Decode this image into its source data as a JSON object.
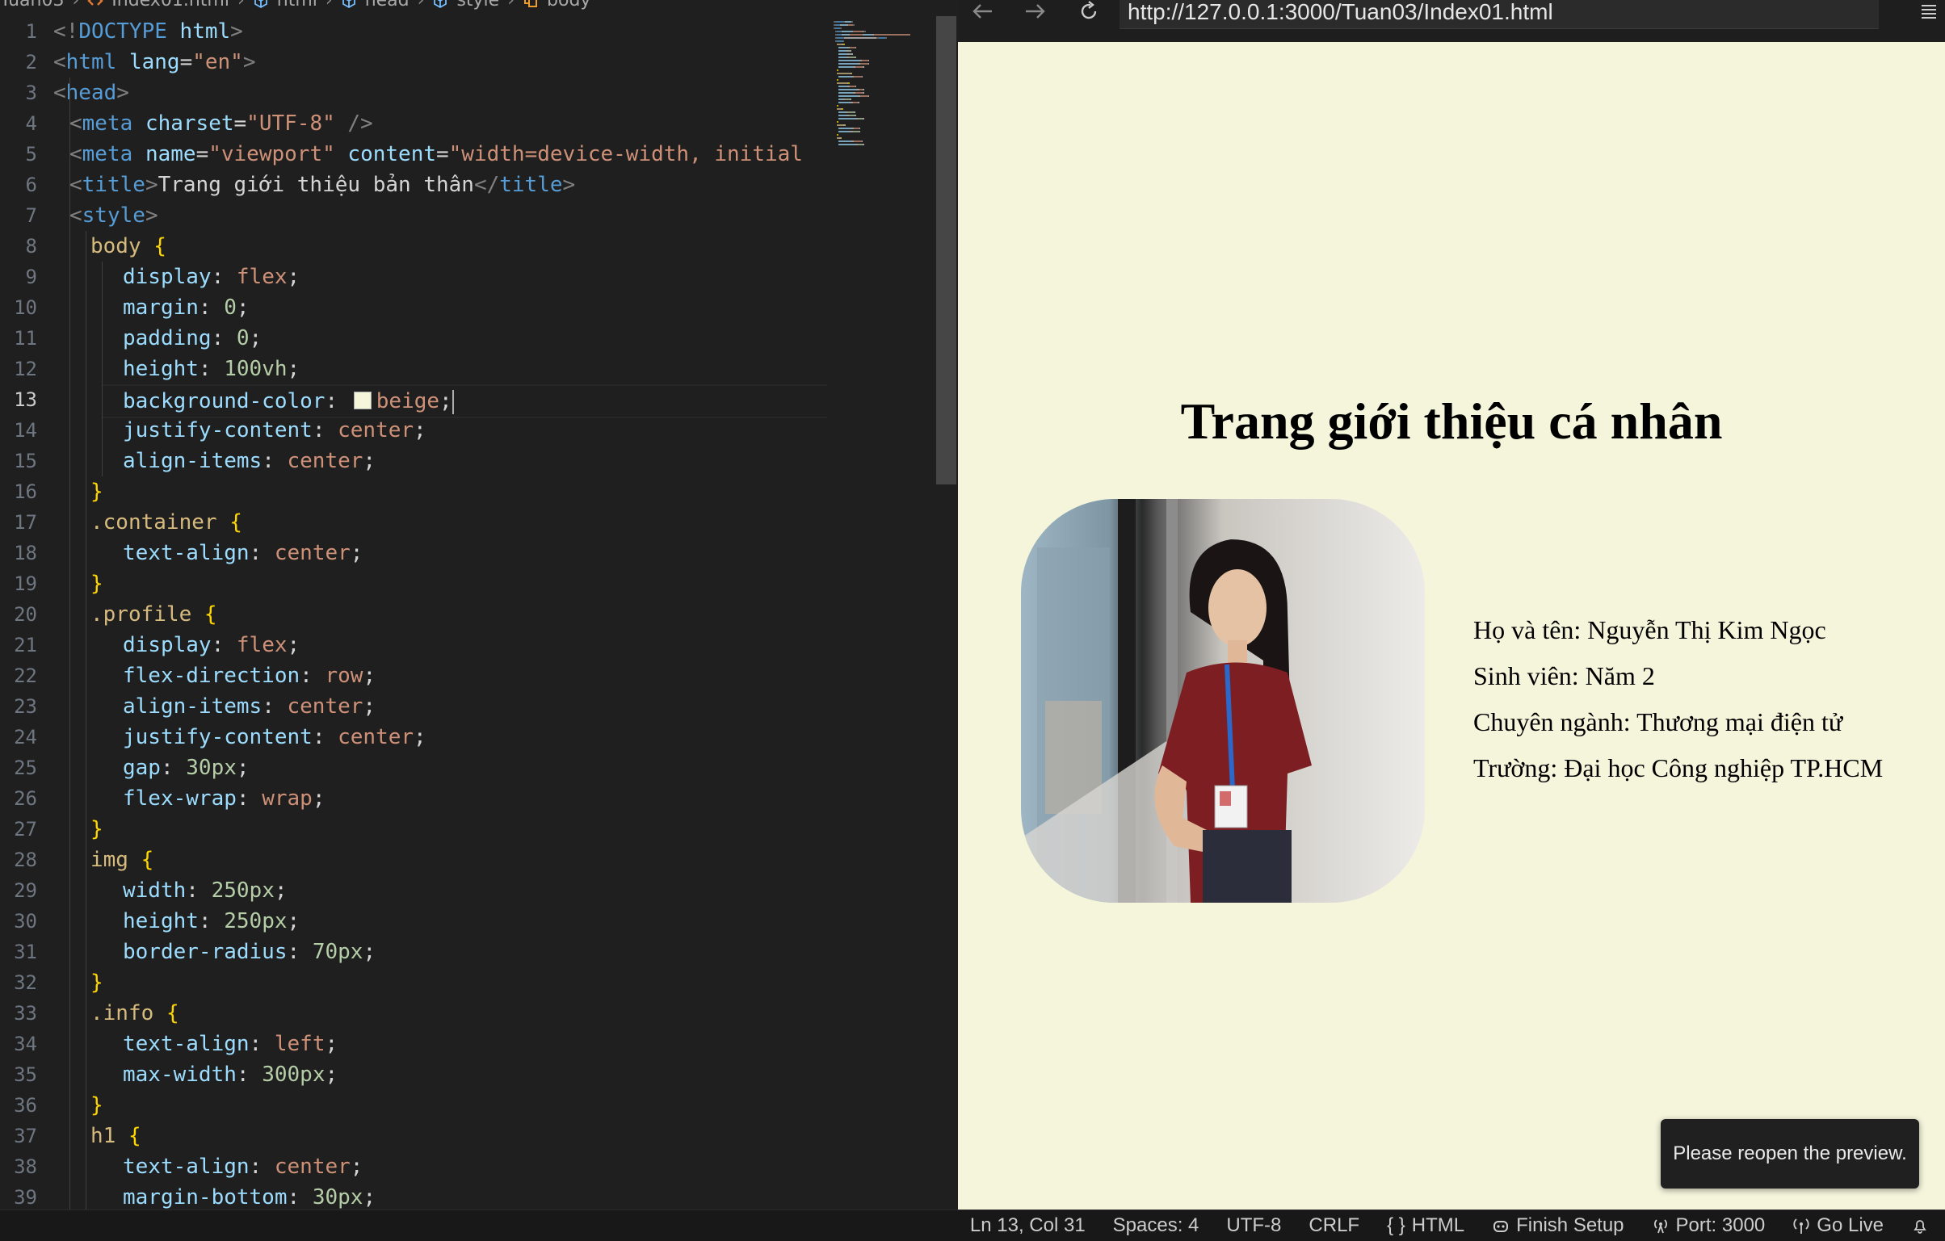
{
  "breadcrumb": [
    "Tuan03",
    "Index01.html",
    "html",
    "head",
    "style",
    "body"
  ],
  "editor": {
    "active_line": 13,
    "lines": [
      {
        "n": 1,
        "indent": 0,
        "tokens": [
          [
            "punc",
            "<!"
          ],
          [
            "tag",
            "DOCTYPE"
          ],
          [
            "text",
            " "
          ],
          [
            "attr",
            "html"
          ],
          [
            "punc",
            ">"
          ]
        ]
      },
      {
        "n": 2,
        "indent": 0,
        "tokens": [
          [
            "punc",
            "<"
          ],
          [
            "tag",
            "html"
          ],
          [
            "text",
            " "
          ],
          [
            "attr",
            "lang"
          ],
          [
            "text",
            "="
          ],
          [
            "str",
            "\"en\""
          ],
          [
            "punc",
            ">"
          ]
        ]
      },
      {
        "n": 3,
        "indent": 0,
        "tokens": [
          [
            "punc",
            "<"
          ],
          [
            "tag",
            "head"
          ],
          [
            "punc",
            ">"
          ]
        ]
      },
      {
        "n": 4,
        "indent": 1,
        "tokens": [
          [
            "punc",
            "<"
          ],
          [
            "tag",
            "meta"
          ],
          [
            "text",
            " "
          ],
          [
            "attr",
            "charset"
          ],
          [
            "text",
            "="
          ],
          [
            "str",
            "\"UTF-8\""
          ],
          [
            "text",
            " "
          ],
          [
            "punc",
            "/>"
          ]
        ]
      },
      {
        "n": 5,
        "indent": 1,
        "tokens": [
          [
            "punc",
            "<"
          ],
          [
            "tag",
            "meta"
          ],
          [
            "text",
            " "
          ],
          [
            "attr",
            "name"
          ],
          [
            "text",
            "="
          ],
          [
            "str",
            "\"viewport\""
          ],
          [
            "text",
            " "
          ],
          [
            "attr",
            "content"
          ],
          [
            "text",
            "="
          ],
          [
            "str",
            "\"width=device-width, initial"
          ]
        ]
      },
      {
        "n": 6,
        "indent": 1,
        "tokens": [
          [
            "punc",
            "<"
          ],
          [
            "tag",
            "title"
          ],
          [
            "punc",
            ">"
          ],
          [
            "text",
            "Trang giới thiệu bản thân"
          ],
          [
            "punc",
            "</"
          ],
          [
            "tag",
            "title"
          ],
          [
            "punc",
            ">"
          ]
        ]
      },
      {
        "n": 7,
        "indent": 1,
        "tokens": [
          [
            "punc",
            "<"
          ],
          [
            "tag",
            "style"
          ],
          [
            "punc",
            ">"
          ]
        ]
      },
      {
        "n": 8,
        "indent": 2,
        "tokens": [
          [
            "sel",
            "body"
          ],
          [
            "text",
            " "
          ],
          [
            "brace",
            "{"
          ]
        ]
      },
      {
        "n": 9,
        "indent": 3,
        "tokens": [
          [
            "prop",
            "display"
          ],
          [
            "colon",
            ": "
          ],
          [
            "val",
            "flex"
          ],
          [
            "colon",
            ";"
          ]
        ]
      },
      {
        "n": 10,
        "indent": 3,
        "tokens": [
          [
            "prop",
            "margin"
          ],
          [
            "colon",
            ": "
          ],
          [
            "num",
            "0"
          ],
          [
            "colon",
            ";"
          ]
        ]
      },
      {
        "n": 11,
        "indent": 3,
        "tokens": [
          [
            "prop",
            "padding"
          ],
          [
            "colon",
            ": "
          ],
          [
            "num",
            "0"
          ],
          [
            "colon",
            ";"
          ]
        ]
      },
      {
        "n": 12,
        "indent": 3,
        "tokens": [
          [
            "prop",
            "height"
          ],
          [
            "colon",
            ": "
          ],
          [
            "num",
            "100vh"
          ],
          [
            "colon",
            ";"
          ]
        ]
      },
      {
        "n": 13,
        "indent": 3,
        "tokens": [
          [
            "prop",
            "background-color"
          ],
          [
            "colon",
            ": "
          ],
          [
            "swatch",
            ""
          ],
          [
            "val",
            "beige"
          ],
          [
            "colon",
            ";"
          ],
          [
            "cursor",
            ""
          ]
        ]
      },
      {
        "n": 14,
        "indent": 3,
        "tokens": [
          [
            "prop",
            "justify-content"
          ],
          [
            "colon",
            ": "
          ],
          [
            "val",
            "center"
          ],
          [
            "colon",
            ";"
          ]
        ]
      },
      {
        "n": 15,
        "indent": 3,
        "tokens": [
          [
            "prop",
            "align-items"
          ],
          [
            "colon",
            ": "
          ],
          [
            "val",
            "center"
          ],
          [
            "colon",
            ";"
          ]
        ]
      },
      {
        "n": 16,
        "indent": 2,
        "tokens": [
          [
            "brace",
            "}"
          ]
        ]
      },
      {
        "n": 17,
        "indent": 2,
        "tokens": [
          [
            "sel",
            ".container"
          ],
          [
            "text",
            " "
          ],
          [
            "brace",
            "{"
          ]
        ]
      },
      {
        "n": 18,
        "indent": 3,
        "tokens": [
          [
            "prop",
            "text-align"
          ],
          [
            "colon",
            ": "
          ],
          [
            "val",
            "center"
          ],
          [
            "colon",
            ";"
          ]
        ]
      },
      {
        "n": 19,
        "indent": 2,
        "tokens": [
          [
            "brace",
            "}"
          ]
        ]
      },
      {
        "n": 20,
        "indent": 2,
        "tokens": [
          [
            "sel",
            ".profile"
          ],
          [
            "text",
            " "
          ],
          [
            "brace",
            "{"
          ]
        ]
      },
      {
        "n": 21,
        "indent": 3,
        "tokens": [
          [
            "prop",
            "display"
          ],
          [
            "colon",
            ": "
          ],
          [
            "val",
            "flex"
          ],
          [
            "colon",
            ";"
          ]
        ]
      },
      {
        "n": 22,
        "indent": 3,
        "tokens": [
          [
            "prop",
            "flex-direction"
          ],
          [
            "colon",
            ": "
          ],
          [
            "val",
            "row"
          ],
          [
            "colon",
            ";"
          ]
        ]
      },
      {
        "n": 23,
        "indent": 3,
        "tokens": [
          [
            "prop",
            "align-items"
          ],
          [
            "colon",
            ": "
          ],
          [
            "val",
            "center"
          ],
          [
            "colon",
            ";"
          ]
        ]
      },
      {
        "n": 24,
        "indent": 3,
        "tokens": [
          [
            "prop",
            "justify-content"
          ],
          [
            "colon",
            ": "
          ],
          [
            "val",
            "center"
          ],
          [
            "colon",
            ";"
          ]
        ]
      },
      {
        "n": 25,
        "indent": 3,
        "tokens": [
          [
            "prop",
            "gap"
          ],
          [
            "colon",
            ": "
          ],
          [
            "num",
            "30px"
          ],
          [
            "colon",
            ";"
          ]
        ]
      },
      {
        "n": 26,
        "indent": 3,
        "tokens": [
          [
            "prop",
            "flex-wrap"
          ],
          [
            "colon",
            ": "
          ],
          [
            "val",
            "wrap"
          ],
          [
            "colon",
            ";"
          ]
        ]
      },
      {
        "n": 27,
        "indent": 2,
        "tokens": [
          [
            "brace",
            "}"
          ]
        ]
      },
      {
        "n": 28,
        "indent": 2,
        "tokens": [
          [
            "sel",
            "img"
          ],
          [
            "text",
            " "
          ],
          [
            "brace",
            "{"
          ]
        ]
      },
      {
        "n": 29,
        "indent": 3,
        "tokens": [
          [
            "prop",
            "width"
          ],
          [
            "colon",
            ": "
          ],
          [
            "num",
            "250px"
          ],
          [
            "colon",
            ";"
          ]
        ]
      },
      {
        "n": 30,
        "indent": 3,
        "tokens": [
          [
            "prop",
            "height"
          ],
          [
            "colon",
            ": "
          ],
          [
            "num",
            "250px"
          ],
          [
            "colon",
            ";"
          ]
        ]
      },
      {
        "n": 31,
        "indent": 3,
        "tokens": [
          [
            "prop",
            "border-radius"
          ],
          [
            "colon",
            ": "
          ],
          [
            "num",
            "70px"
          ],
          [
            "colon",
            ";"
          ]
        ]
      },
      {
        "n": 32,
        "indent": 2,
        "tokens": [
          [
            "brace",
            "}"
          ]
        ]
      },
      {
        "n": 33,
        "indent": 2,
        "tokens": [
          [
            "sel",
            ".info"
          ],
          [
            "text",
            " "
          ],
          [
            "brace",
            "{"
          ]
        ]
      },
      {
        "n": 34,
        "indent": 3,
        "tokens": [
          [
            "prop",
            "text-align"
          ],
          [
            "colon",
            ": "
          ],
          [
            "val",
            "left"
          ],
          [
            "colon",
            ";"
          ]
        ]
      },
      {
        "n": 35,
        "indent": 3,
        "tokens": [
          [
            "prop",
            "max-width"
          ],
          [
            "colon",
            ": "
          ],
          [
            "num",
            "300px"
          ],
          [
            "colon",
            ";"
          ]
        ]
      },
      {
        "n": 36,
        "indent": 2,
        "tokens": [
          [
            "brace",
            "}"
          ]
        ]
      },
      {
        "n": 37,
        "indent": 2,
        "tokens": [
          [
            "sel",
            "h1"
          ],
          [
            "text",
            " "
          ],
          [
            "brace",
            "{"
          ]
        ]
      },
      {
        "n": 38,
        "indent": 3,
        "tokens": [
          [
            "prop",
            "text-align"
          ],
          [
            "colon",
            ": "
          ],
          [
            "val",
            "center"
          ],
          [
            "colon",
            ";"
          ]
        ]
      },
      {
        "n": 39,
        "indent": 3,
        "tokens": [
          [
            "prop",
            "margin-bottom"
          ],
          [
            "colon",
            ": "
          ],
          [
            "num",
            "30px"
          ],
          [
            "colon",
            ";"
          ]
        ]
      }
    ]
  },
  "preview": {
    "url": "http://127.0.0.1:3000/Tuan03/Index01.html",
    "page_title": "Trang giới thiệu cá nhân",
    "info": [
      "Họ và tên: Nguyễn Thị Kim Ngọc",
      "Sinh viên: Năm 2",
      "Chuyên ngành: Thương mại điện tử",
      "Trường: Đại học Công nghiệp TP.HCM"
    ],
    "toast": "Please reopen the preview.",
    "page_background": "#f5f5dc"
  },
  "status_bar": {
    "position": "Ln 13, Col 31",
    "spaces": "Spaces: 4",
    "encoding": "UTF-8",
    "eol": "CRLF",
    "language": "HTML",
    "finish_setup": "Finish Setup",
    "port": "Port: 3000",
    "go_live": "Go Live"
  }
}
